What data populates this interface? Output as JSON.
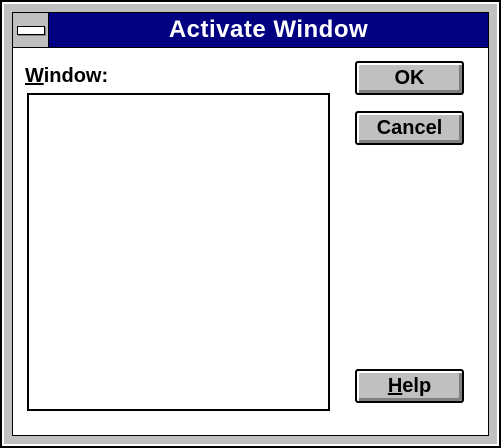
{
  "dialog": {
    "title": "Activate Window",
    "list_label_mnemonic": "W",
    "list_label_rest": "indow:",
    "window_list_items": []
  },
  "buttons": {
    "ok_label": "OK",
    "cancel_label": "Cancel",
    "help_mnemonic": "H",
    "help_rest": "elp"
  },
  "colors": {
    "title_bar": "#000080",
    "button_face": "#c0c0c0",
    "frame": "#c0c0c0"
  },
  "icons": {
    "system_menu": "system-menu-icon"
  }
}
